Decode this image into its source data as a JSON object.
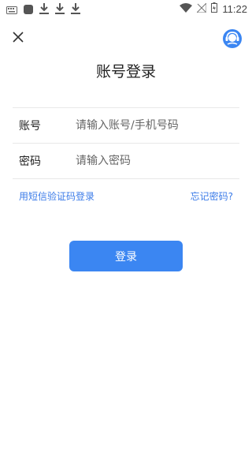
{
  "status_bar": {
    "time": "11:22",
    "icons": [
      "keyboard-icon",
      "app-icon",
      "download-icon",
      "download-icon",
      "download-icon",
      "wifi-icon",
      "no-signal-icon",
      "battery-icon"
    ]
  },
  "header": {
    "close_icon": "close-icon",
    "service_icon": "customer-service-icon",
    "title": "账号登录"
  },
  "form": {
    "account_label": "账号",
    "account_placeholder": "请输入账号/手机号码",
    "password_label": "密码",
    "password_placeholder": "请输入密码"
  },
  "links": {
    "sms_login": "用短信验证码登录",
    "forgot_password": "忘记密码?"
  },
  "login_button": "登录",
  "colors": {
    "accent": "#3b86f2",
    "link": "#3b7be8"
  }
}
